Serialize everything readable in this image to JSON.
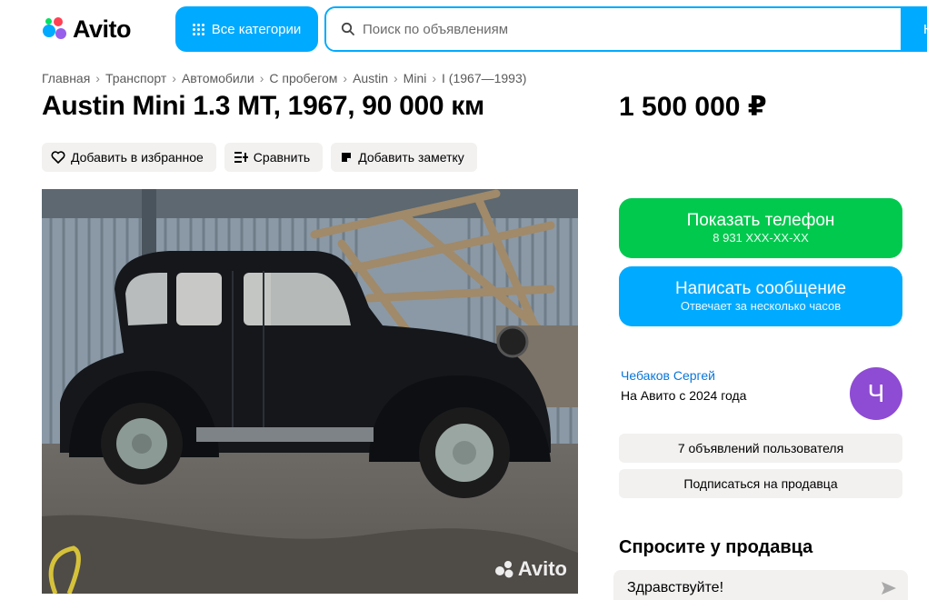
{
  "header": {
    "logo_text": "Avito",
    "categories_label": "Все категории",
    "search_placeholder": "Поиск по объявлениям",
    "search_button": "Н"
  },
  "breadcrumb": [
    "Главная",
    "Транспорт",
    "Автомобили",
    "С пробегом",
    "Austin",
    "Mini",
    "I (1967—1993)"
  ],
  "breadcrumb_sep": "›",
  "listing": {
    "title": "Austin Mini 1.3 MT, 1967, 90 000 км",
    "price": "1 500 000 ₽",
    "watermark": "Avito"
  },
  "actions": {
    "favorite": "Добавить в избранное",
    "compare": "Сравнить",
    "note": "Добавить заметку"
  },
  "contact": {
    "phone_label": "Показать телефон",
    "phone_masked": "8 931 XXX-XX-XX",
    "message_label": "Написать сообщение",
    "message_sub": "Отвечает за несколько часов"
  },
  "seller": {
    "name": "Чебаков Сергей",
    "since": "На Авито с 2024 года",
    "avatar_letter": "Ч",
    "listings_count": "7 объявлений пользователя",
    "subscribe": "Подписаться на продавца"
  },
  "ask": {
    "title": "Спросите у продавца",
    "prefill": "Здравствуйте!"
  },
  "colors": {
    "blue": "#00aaff",
    "green": "#00c94e",
    "avatar": "#8e4bd3",
    "chip_bg": "#f2f1f0"
  }
}
